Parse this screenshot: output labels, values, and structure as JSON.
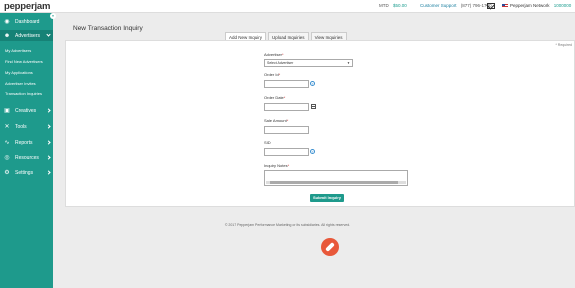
{
  "header": {
    "logo": "pepperjam",
    "mtd_label": "MTD",
    "mtd_value": "$50.00",
    "support_label": "Customer Support",
    "support_phone": "(877) 796-1700",
    "network_label": "Pepperjam Network",
    "network_id": "1000000",
    "icons": [
      "mail-icon",
      "flag-icon"
    ]
  },
  "sidebar": {
    "items": [
      {
        "label": "Dashboard",
        "icon": "dashboard-icon"
      },
      {
        "label": "Advertisers",
        "icon": "users-icon"
      },
      {
        "label": "Creatives",
        "icon": "creatives-icon"
      },
      {
        "label": "Tools",
        "icon": "tools-icon"
      },
      {
        "label": "Reports",
        "icon": "reports-icon"
      },
      {
        "label": "Resources",
        "icon": "resources-icon"
      },
      {
        "label": "Settings",
        "icon": "settings-icon"
      }
    ],
    "sub_items": [
      "My Advertisers",
      "Find New Advertisers",
      "My Applications",
      "Advertiser Invites",
      "Transaction Inquiries"
    ]
  },
  "page": {
    "title": "New Transaction Inquiry",
    "tabs": [
      "Add New Inquiry",
      "Upload Inquiries",
      "View Inquiries"
    ],
    "required_note": "* Required"
  },
  "form": {
    "advertiser_label": "Advertiser",
    "advertiser_value": "Select Advertiser",
    "order_id_label": "Order Id",
    "order_date_label": "Order Date",
    "sale_amount_label": "Sale Amount",
    "sid_label": "SID",
    "notes_label": "Inquiry Notes",
    "asterisk": "*",
    "submit_label": "Submit Inquiry"
  },
  "footer": {
    "copyright": "© 2017 Pepperjam Performance Marketing or its subsidiaries. All rights reserved."
  },
  "colors": {
    "brand": "#1e9a8c",
    "brand_dark": "#168276",
    "bug_button": "#e8583a"
  }
}
